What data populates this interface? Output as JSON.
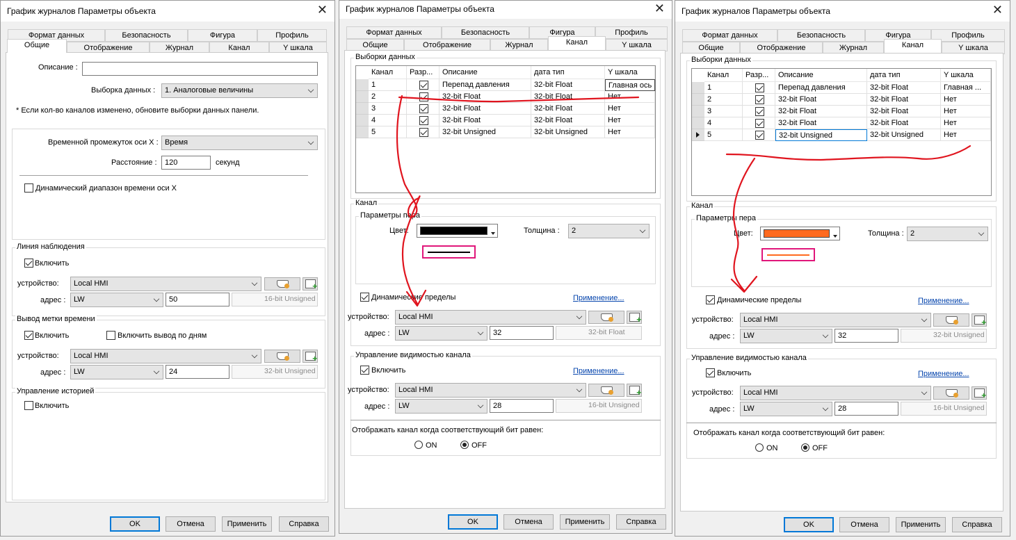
{
  "dialogs": [
    {
      "title": "График журналов Параметры объекта",
      "tabs_row1": [
        "Формат данных",
        "Безопасность",
        "Фигура",
        "Профиль"
      ],
      "tabs_row2": [
        "Общие",
        "Отображение",
        "Журнал",
        "Канал",
        "Y шкала"
      ],
      "active_tab": "Общие",
      "general": {
        "description_label": "Описание :",
        "description_value": "",
        "sample_label": "Выборка данных :",
        "sample_value": "1. Аналоговые величины",
        "note": "* Если кол-во каналов изменено, обновите выборки данных панели.",
        "time_span_label": "Временной промежуток оси X :",
        "time_span_value": "Время",
        "distance_label": "Расстояние :",
        "distance_value": "120",
        "distance_unit": "секунд",
        "dynamic_range_label": "Динамический диапазон времени оси X",
        "dynamic_range_checked": false,
        "watch_line": {
          "title": "Линия наблюдения",
          "enable_label": "Включить",
          "enable_checked": true,
          "device_label": "устройство:",
          "device_value": "Local HMI",
          "address_label": "адрес :",
          "address_type": "LW",
          "address_value": "50",
          "data_type": "16-bit Unsigned"
        },
        "time_tag": {
          "title": "Вывод метки времени",
          "enable_label": "Включить",
          "enable_checked": true,
          "by_days_label": "Включить вывод по дням",
          "by_days_checked": false,
          "device_label": "устройство:",
          "device_value": "Local HMI",
          "address_label": "адрес :",
          "address_type": "LW",
          "address_value": "24",
          "data_type": "32-bit Unsigned"
        },
        "history": {
          "title": "Управление историей",
          "enable_label": "Включить",
          "enable_checked": false
        }
      },
      "buttons": [
        "OK",
        "Отмена",
        "Применить",
        "Справка"
      ]
    },
    {
      "title": "График журналов Параметры объекта",
      "tabs_row1": [
        "Формат данных",
        "Безопасность",
        "Фигура",
        "Профиль"
      ],
      "tabs_row2": [
        "Общие",
        "Отображение",
        "Журнал",
        "Канал",
        "Y шкала"
      ],
      "active_tab": "Канал",
      "channel": {
        "samples_title": "Выборки данных",
        "columns": [
          "Канал",
          "Разр...",
          "Описание",
          "дата тип",
          "Y шкала"
        ],
        "rows": [
          {
            "ch": "1",
            "on": true,
            "desc": "Перепад давления",
            "type": "32-bit Float",
            "y": "Главная ось"
          },
          {
            "ch": "2",
            "on": true,
            "desc": "32-bit Float",
            "type": "32-bit Float",
            "y": "Нет"
          },
          {
            "ch": "3",
            "on": true,
            "desc": "32-bit Float",
            "type": "32-bit Float",
            "y": "Нет"
          },
          {
            "ch": "4",
            "on": true,
            "desc": "32-bit Float",
            "type": "32-bit Float",
            "y": "Нет"
          },
          {
            "ch": "5",
            "on": true,
            "desc": "32-bit Unsigned",
            "type": "32-bit Unsigned",
            "y": "Нет"
          }
        ],
        "channel_title": "Канал",
        "pen_title": "Параметры пера",
        "color_label": "Цвет:",
        "color_value": "#000000",
        "thickness_label": "Толщина :",
        "thickness_value": "2",
        "dynamic_limits_label": "Динамические пределы",
        "dynamic_limits_checked": true,
        "apply_link": "Применение...",
        "device_label": "устройство:",
        "device_value": "Local HMI",
        "address_label": "адрес :",
        "address_type": "LW",
        "address_value": "32",
        "data_type": "32-bit Float",
        "visibility_title": "Управление видимостью канала",
        "vis_enable_label": "Включить",
        "vis_enable_checked": true,
        "vis_apply_link": "Применение...",
        "vis_device_value": "Local HMI",
        "vis_address_type": "LW",
        "vis_address_value": "28",
        "vis_data_type": "16-bit Unsigned",
        "bit_label": "Отображать канал когда соответствующий бит равен:",
        "on_label": "ON",
        "off_label": "OFF",
        "bit_value": "OFF"
      },
      "buttons": [
        "OK",
        "Отмена",
        "Применить",
        "Справка"
      ]
    },
    {
      "title": "График журналов Параметры объекта",
      "tabs_row1": [
        "Формат данных",
        "Безопасность",
        "Фигура",
        "Профиль"
      ],
      "tabs_row2": [
        "Общие",
        "Отображение",
        "Журнал",
        "Канал",
        "Y шкала"
      ],
      "active_tab": "Канал",
      "channel": {
        "samples_title": "Выборки данных",
        "columns": [
          "Канал",
          "Разр...",
          "Описание",
          "дата тип",
          "Y шкала"
        ],
        "rows": [
          {
            "ch": "1",
            "on": true,
            "desc": "Перепад давления",
            "type": "32-bit Float",
            "y": "Главная ..."
          },
          {
            "ch": "2",
            "on": true,
            "desc": "32-bit Float",
            "type": "32-bit Float",
            "y": "Нет"
          },
          {
            "ch": "3",
            "on": true,
            "desc": "32-bit Float",
            "type": "32-bit Float",
            "y": "Нет"
          },
          {
            "ch": "4",
            "on": true,
            "desc": "32-bit Float",
            "type": "32-bit Float",
            "y": "Нет"
          },
          {
            "ch": "5",
            "on": true,
            "desc": "32-bit Unsigned",
            "type": "32-bit Unsigned",
            "y": "Нет"
          }
        ],
        "selected_row": "5",
        "channel_title": "Канал",
        "pen_title": "Параметры пера",
        "color_label": "Цвет:",
        "color_value": "#ff6a1f",
        "thickness_label": "Толщина :",
        "thickness_value": "2",
        "dynamic_limits_label": "Динамические пределы",
        "dynamic_limits_checked": true,
        "apply_link": "Применение...",
        "device_label": "устройство:",
        "device_value": "Local HMI",
        "address_label": "адрес :",
        "address_type": "LW",
        "address_value": "32",
        "data_type": "32-bit Unsigned",
        "visibility_title": "Управление видимостью канала",
        "vis_enable_label": "Включить",
        "vis_enable_checked": true,
        "vis_apply_link": "Применение...",
        "vis_device_value": "Local HMI",
        "vis_address_type": "LW",
        "vis_address_value": "28",
        "vis_data_type": "16-bit Unsigned",
        "bit_label": "Отображать канал когда соответствующий бит равен:",
        "on_label": "ON",
        "off_label": "OFF",
        "bit_value": "OFF"
      },
      "buttons": [
        "OK",
        "Отмена",
        "Применить",
        "Справка"
      ]
    }
  ],
  "colors": {
    "accent": "#0078d7",
    "annotation": "#e0141e",
    "highlight_box": "#e0167a",
    "link": "#0645ad"
  }
}
